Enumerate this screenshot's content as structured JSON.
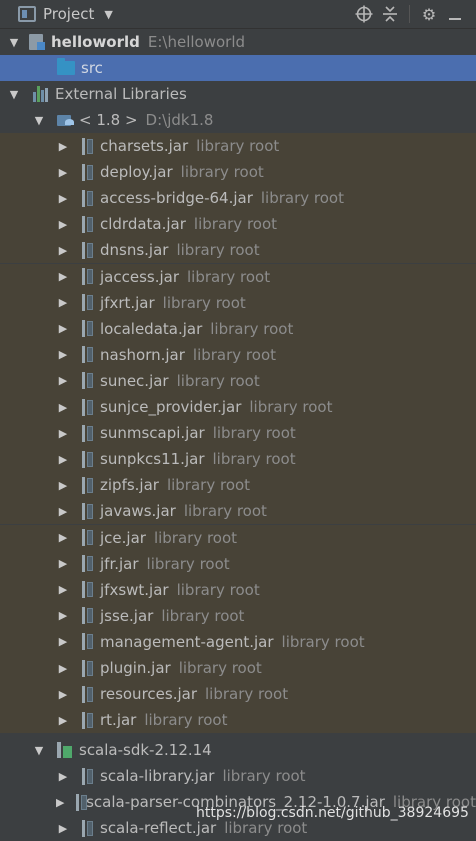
{
  "header": {
    "title": "Project",
    "icons": [
      "project-view-icon",
      "chevron-down-icon",
      "locate-icon",
      "collapse-all-icon",
      "gear-icon",
      "hide-icon"
    ]
  },
  "tree": {
    "project": {
      "name": "helloworld",
      "path": "E:\\helloworld"
    },
    "src": {
      "label": "src"
    },
    "external_libraries": {
      "label": "External Libraries"
    },
    "jdk": {
      "name": "< 1.8 >",
      "path": "D:\\jdk1.8"
    },
    "jdk_jars": [
      "charsets.jar",
      "deploy.jar",
      "access-bridge-64.jar",
      "cldrdata.jar",
      "dnsns.jar",
      "jaccess.jar",
      "jfxrt.jar",
      "localedata.jar",
      "nashorn.jar",
      "sunec.jar",
      "sunjce_provider.jar",
      "sunmscapi.jar",
      "sunpkcs11.jar",
      "zipfs.jar",
      "javaws.jar",
      "jce.jar",
      "jfr.jar",
      "jfxswt.jar",
      "jsse.jar",
      "management-agent.jar",
      "plugin.jar",
      "resources.jar",
      "rt.jar"
    ],
    "library_root_label": "library root",
    "scala_sdk": {
      "name": "scala-sdk-2.12.14"
    },
    "scala_jars": [
      "scala-library.jar",
      "scala-parser-combinators_2.12-1.0.7.jar",
      "scala-reflect.jar"
    ]
  },
  "watermark": "https://blog.csdn.net/github_38924695",
  "colors": {
    "background": "#3c3f41",
    "selection": "#4b6eaf",
    "library_bg": "#484337",
    "muted_text": "#8c8c8c"
  }
}
